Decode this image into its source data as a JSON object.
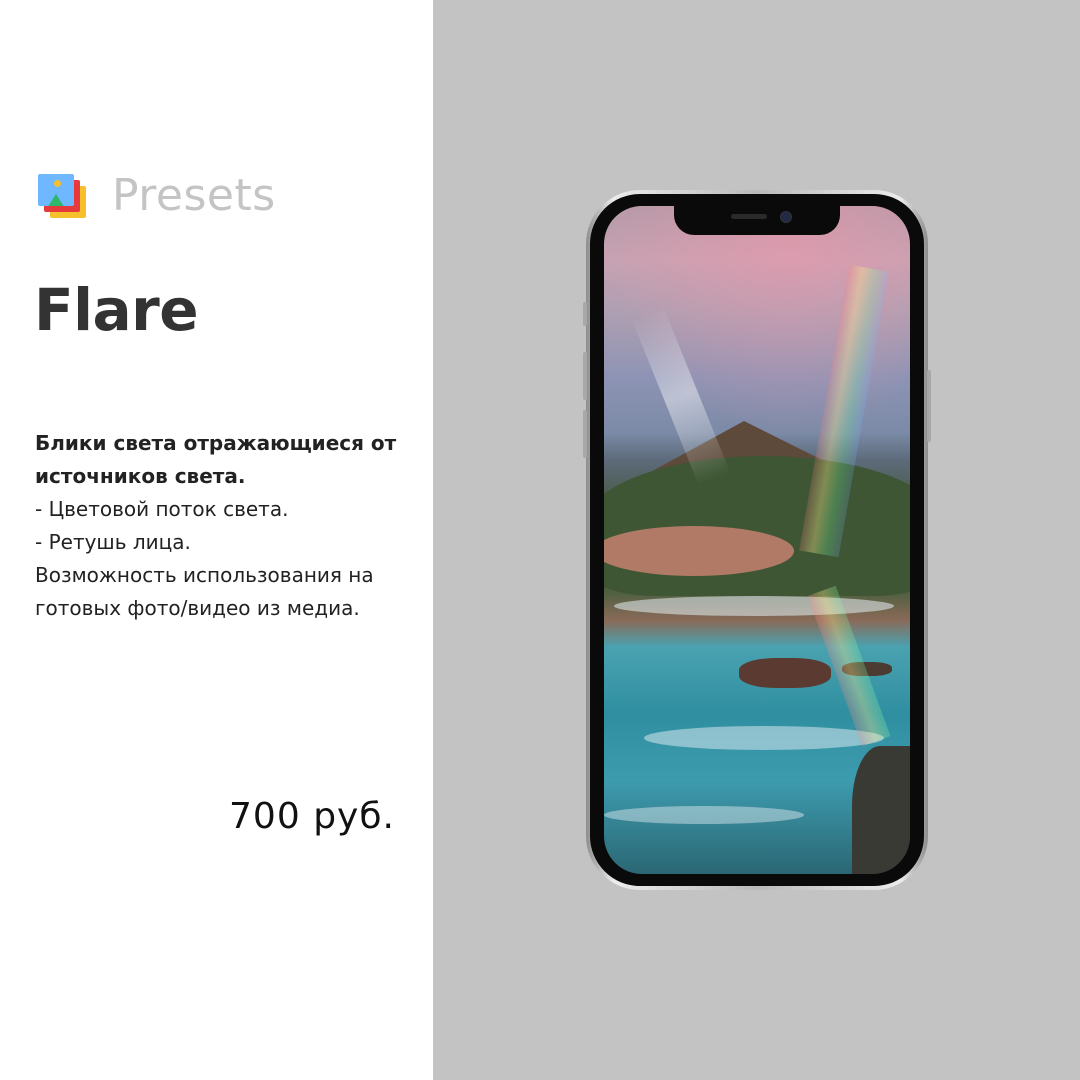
{
  "brand": {
    "name": "Presets",
    "logo_icon": "layered-images-icon",
    "text_color": "#c4c4c4"
  },
  "product": {
    "title": "Flare",
    "description": {
      "heading_line1": "Блики света отражающиеся от",
      "heading_line2": "источников света.",
      "bullet1": "- Цветовой поток света.",
      "bullet2": "- Ретушь лица.",
      "note_line1": "Возможность использования на",
      "note_line2": "готовых фото/видео из медиа."
    },
    "price": "700 руб."
  },
  "colors": {
    "left_background": "#ffffff",
    "right_background": "#c3c3c3",
    "title_color": "#333333"
  },
  "preview": {
    "device": "smartphone-mockup",
    "scene": "coastal-landscape-with-light-flare"
  }
}
